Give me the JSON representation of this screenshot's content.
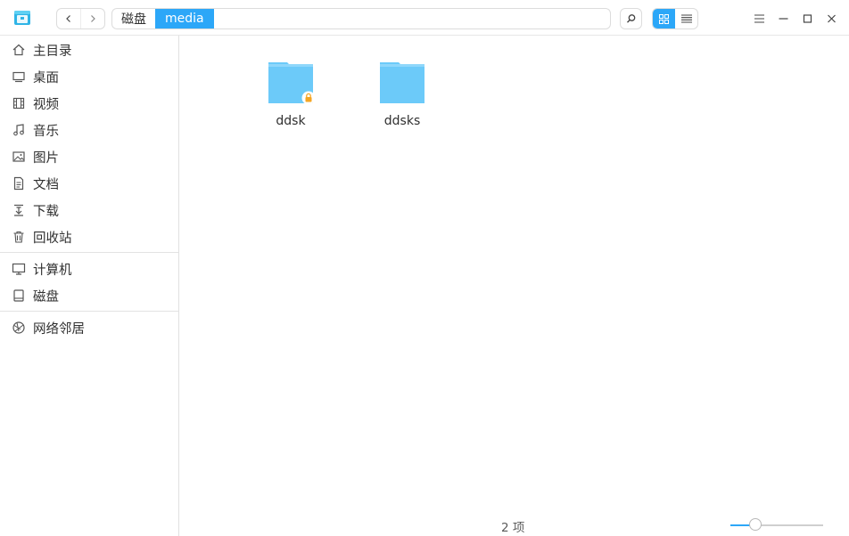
{
  "titlebar": {
    "app_icon": "file-manager-app-icon",
    "nav": {
      "back_icon": "chevron-left-icon",
      "forward_icon": "chevron-right-icon"
    },
    "breadcrumb": [
      {
        "label": "磁盘",
        "active": false
      },
      {
        "label": "media",
        "active": true
      }
    ],
    "search_icon": "search-icon",
    "view_modes": [
      {
        "icon": "grid-view-icon",
        "active": true
      },
      {
        "icon": "list-view-icon",
        "active": false
      }
    ],
    "window_controls": [
      "menu-icon",
      "minimize-icon",
      "maximize-icon",
      "close-icon"
    ]
  },
  "sidebar": {
    "groups": [
      [
        {
          "label": "主目录",
          "icon": "home-icon"
        },
        {
          "label": "桌面",
          "icon": "desktop-icon"
        },
        {
          "label": "视频",
          "icon": "video-icon"
        },
        {
          "label": "音乐",
          "icon": "music-icon"
        },
        {
          "label": "图片",
          "icon": "picture-icon"
        },
        {
          "label": "文档",
          "icon": "document-icon"
        },
        {
          "label": "下载",
          "icon": "download-icon"
        },
        {
          "label": "回收站",
          "icon": "trash-icon"
        }
      ],
      [
        {
          "label": "计算机",
          "icon": "computer-icon"
        },
        {
          "label": "磁盘",
          "icon": "disk-icon"
        }
      ],
      [
        {
          "label": "网络邻居",
          "icon": "network-icon"
        }
      ]
    ]
  },
  "files": [
    {
      "name": "ddsk",
      "icon": "folder-icon",
      "locked": true
    },
    {
      "name": "ddsks",
      "icon": "folder-icon",
      "locked": false
    }
  ],
  "status_bar": {
    "item_count": "2 项",
    "zoom_level": 0.27
  },
  "colors": {
    "accent": "#2ca7f8",
    "folder": "#6ccaf9",
    "lock_badge": "#f5a623"
  }
}
